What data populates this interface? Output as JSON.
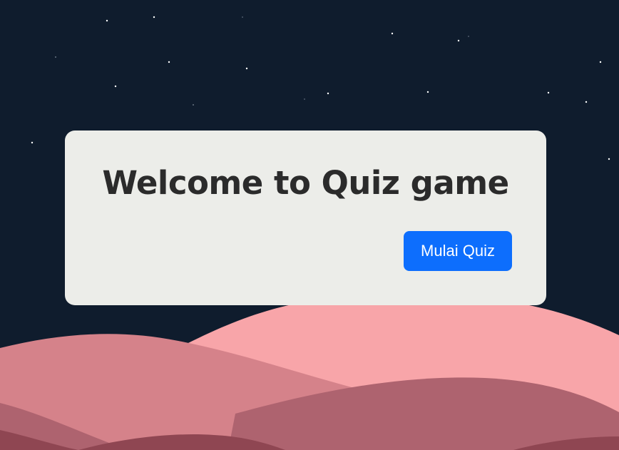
{
  "quiz_card": {
    "title": "Welcome to Quiz game",
    "start_button_label": "Mulai Quiz"
  },
  "colors": {
    "sky": "#0f1c2d",
    "card_background": "#ecede9",
    "title_text": "#2b2b2b",
    "button_accent": "#0d6efd",
    "hill_back": "#f8a5a9",
    "hill_middle": "#d5828a",
    "hill_front": "#ae636f",
    "hill_foreground": "#8f4652",
    "star": "#ffffff"
  }
}
